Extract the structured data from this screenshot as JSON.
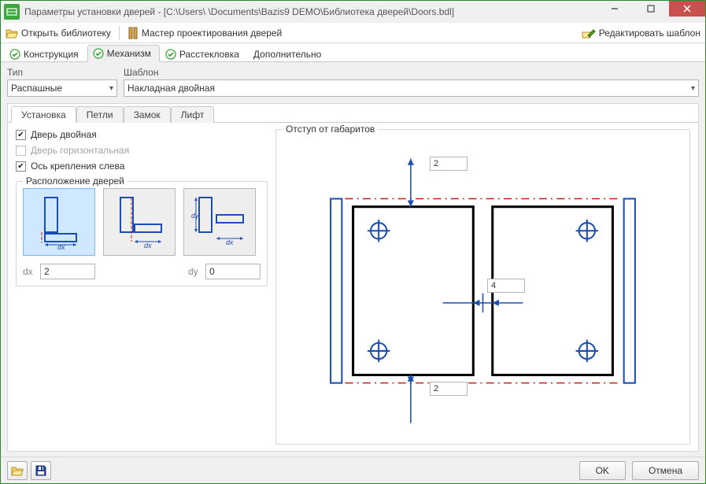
{
  "window": {
    "title": "Параметры установки дверей - [C:\\Users\\         \\Documents\\Bazis9 DEMO\\Библиотека дверей\\Doors.bdl]"
  },
  "toolbar": {
    "open_library": "Открыть библиотеку",
    "door_wizard": "Мастер проектирования дверей",
    "edit_template": "Редактировать шаблон"
  },
  "main_tabs": {
    "construction": "Конструкция",
    "mechanism": "Механизм",
    "glazing": "Расстекловка",
    "extra": "Дополнительно"
  },
  "type": {
    "label": "Тип",
    "value": "Распашные"
  },
  "template": {
    "label": "Шаблон",
    "value": "Накладная двойная"
  },
  "sub_tabs": {
    "install": "Установка",
    "hinges": "Петли",
    "lock": "Замок",
    "lift": "Лифт"
  },
  "checks": {
    "double_door": "Дверь двойная",
    "horizontal_door": "Дверь горизонтальная",
    "hinge_left": "Ось крепления слева"
  },
  "layout_group": {
    "title": "Расположение дверей"
  },
  "dx": {
    "label": "dx",
    "value": "2"
  },
  "dy": {
    "label": "dy",
    "value": "0"
  },
  "offset_group": {
    "title": "Отступ от габаритов",
    "top": "2",
    "middle": "4",
    "bottom": "2"
  },
  "buttons": {
    "ok": "OK",
    "cancel": "Отмена"
  }
}
